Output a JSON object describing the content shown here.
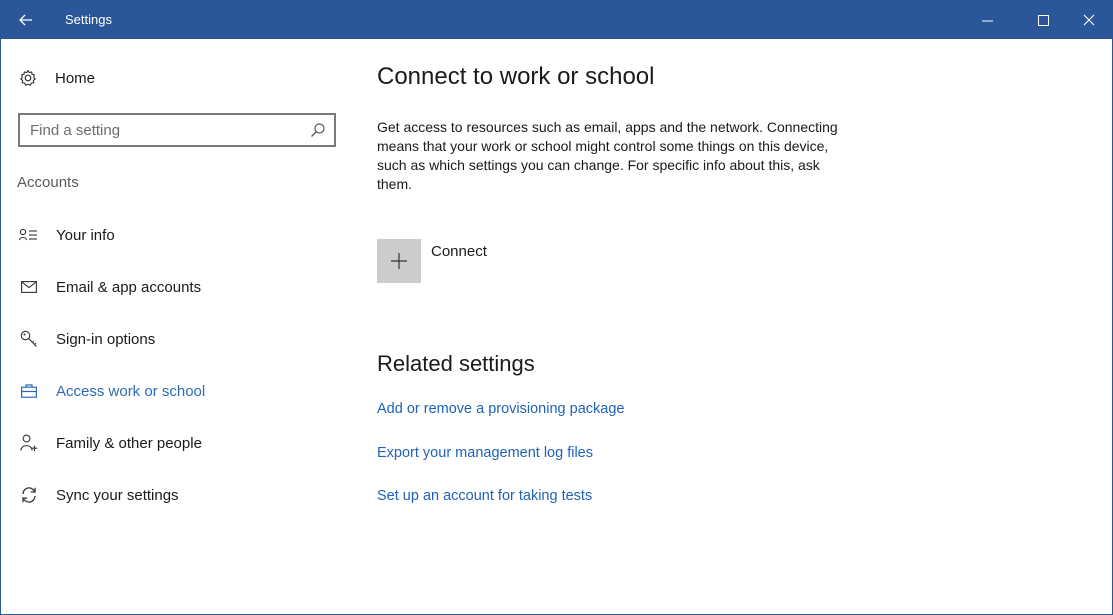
{
  "window": {
    "title": "Settings",
    "accent_color": "#2b579a",
    "controls": [
      "minimize-icon",
      "maximize-icon",
      "close-icon"
    ]
  },
  "sidebar": {
    "home_label": "Home",
    "search_placeholder": "Find a setting",
    "section_heading": "Accounts",
    "items": [
      {
        "label": "Your info",
        "icon": "your-info-icon",
        "active": false
      },
      {
        "label": "Email & app accounts",
        "icon": "mail-icon",
        "active": false
      },
      {
        "label": "Sign-in options",
        "icon": "key-icon",
        "active": false
      },
      {
        "label": "Access work or school",
        "icon": "briefcase-icon",
        "active": true
      },
      {
        "label": "Family & other people",
        "icon": "add-person-icon",
        "active": false
      },
      {
        "label": "Sync your settings",
        "icon": "sync-icon",
        "active": false
      }
    ],
    "active_color": "#2b6cb8"
  },
  "main": {
    "title": "Connect to work or school",
    "description": "Get access to resources such as email, apps and the network. Connecting means that your work or school might control some things on this device, such as which settings you can change. For specific info about this, ask them.",
    "connect_label": "Connect",
    "related_title": "Related settings",
    "links": [
      "Add or remove a provisioning package",
      "Export your management log files",
      "Set up an account for taking tests"
    ],
    "link_color": "#1f62b8"
  }
}
